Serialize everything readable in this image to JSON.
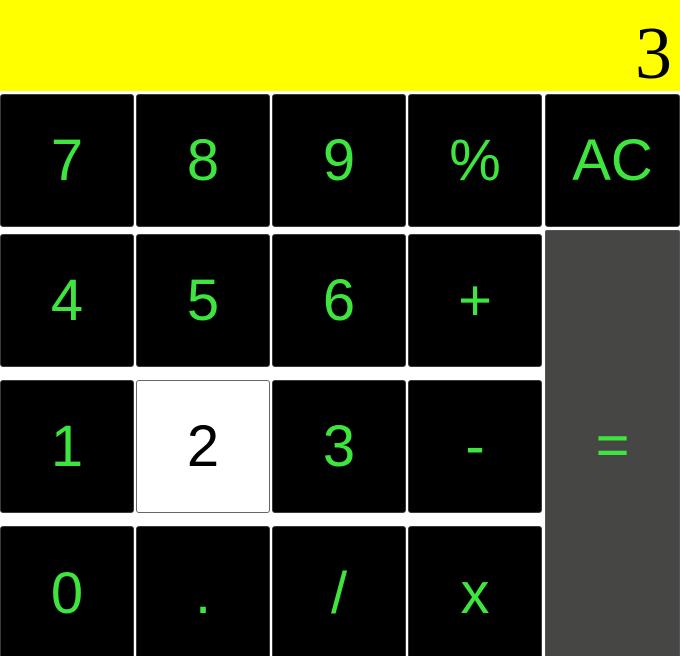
{
  "display": {
    "value": "3"
  },
  "keys": {
    "k7": "7",
    "k8": "8",
    "k9": "9",
    "percent": "%",
    "clear": "AC",
    "k4": "4",
    "k5": "5",
    "k6": "6",
    "plus": "+",
    "k1": "1",
    "k2": "2",
    "k3": "3",
    "minus": "-",
    "equals": "=",
    "k0": "0",
    "dot": ".",
    "divide": "/",
    "multiply": "x"
  },
  "colors": {
    "display_background": "#ffff00",
    "key_background": "#000000",
    "key_text": "#3ee53e",
    "pressed_key_background": "#ffffff",
    "equals_background": "#464744"
  }
}
